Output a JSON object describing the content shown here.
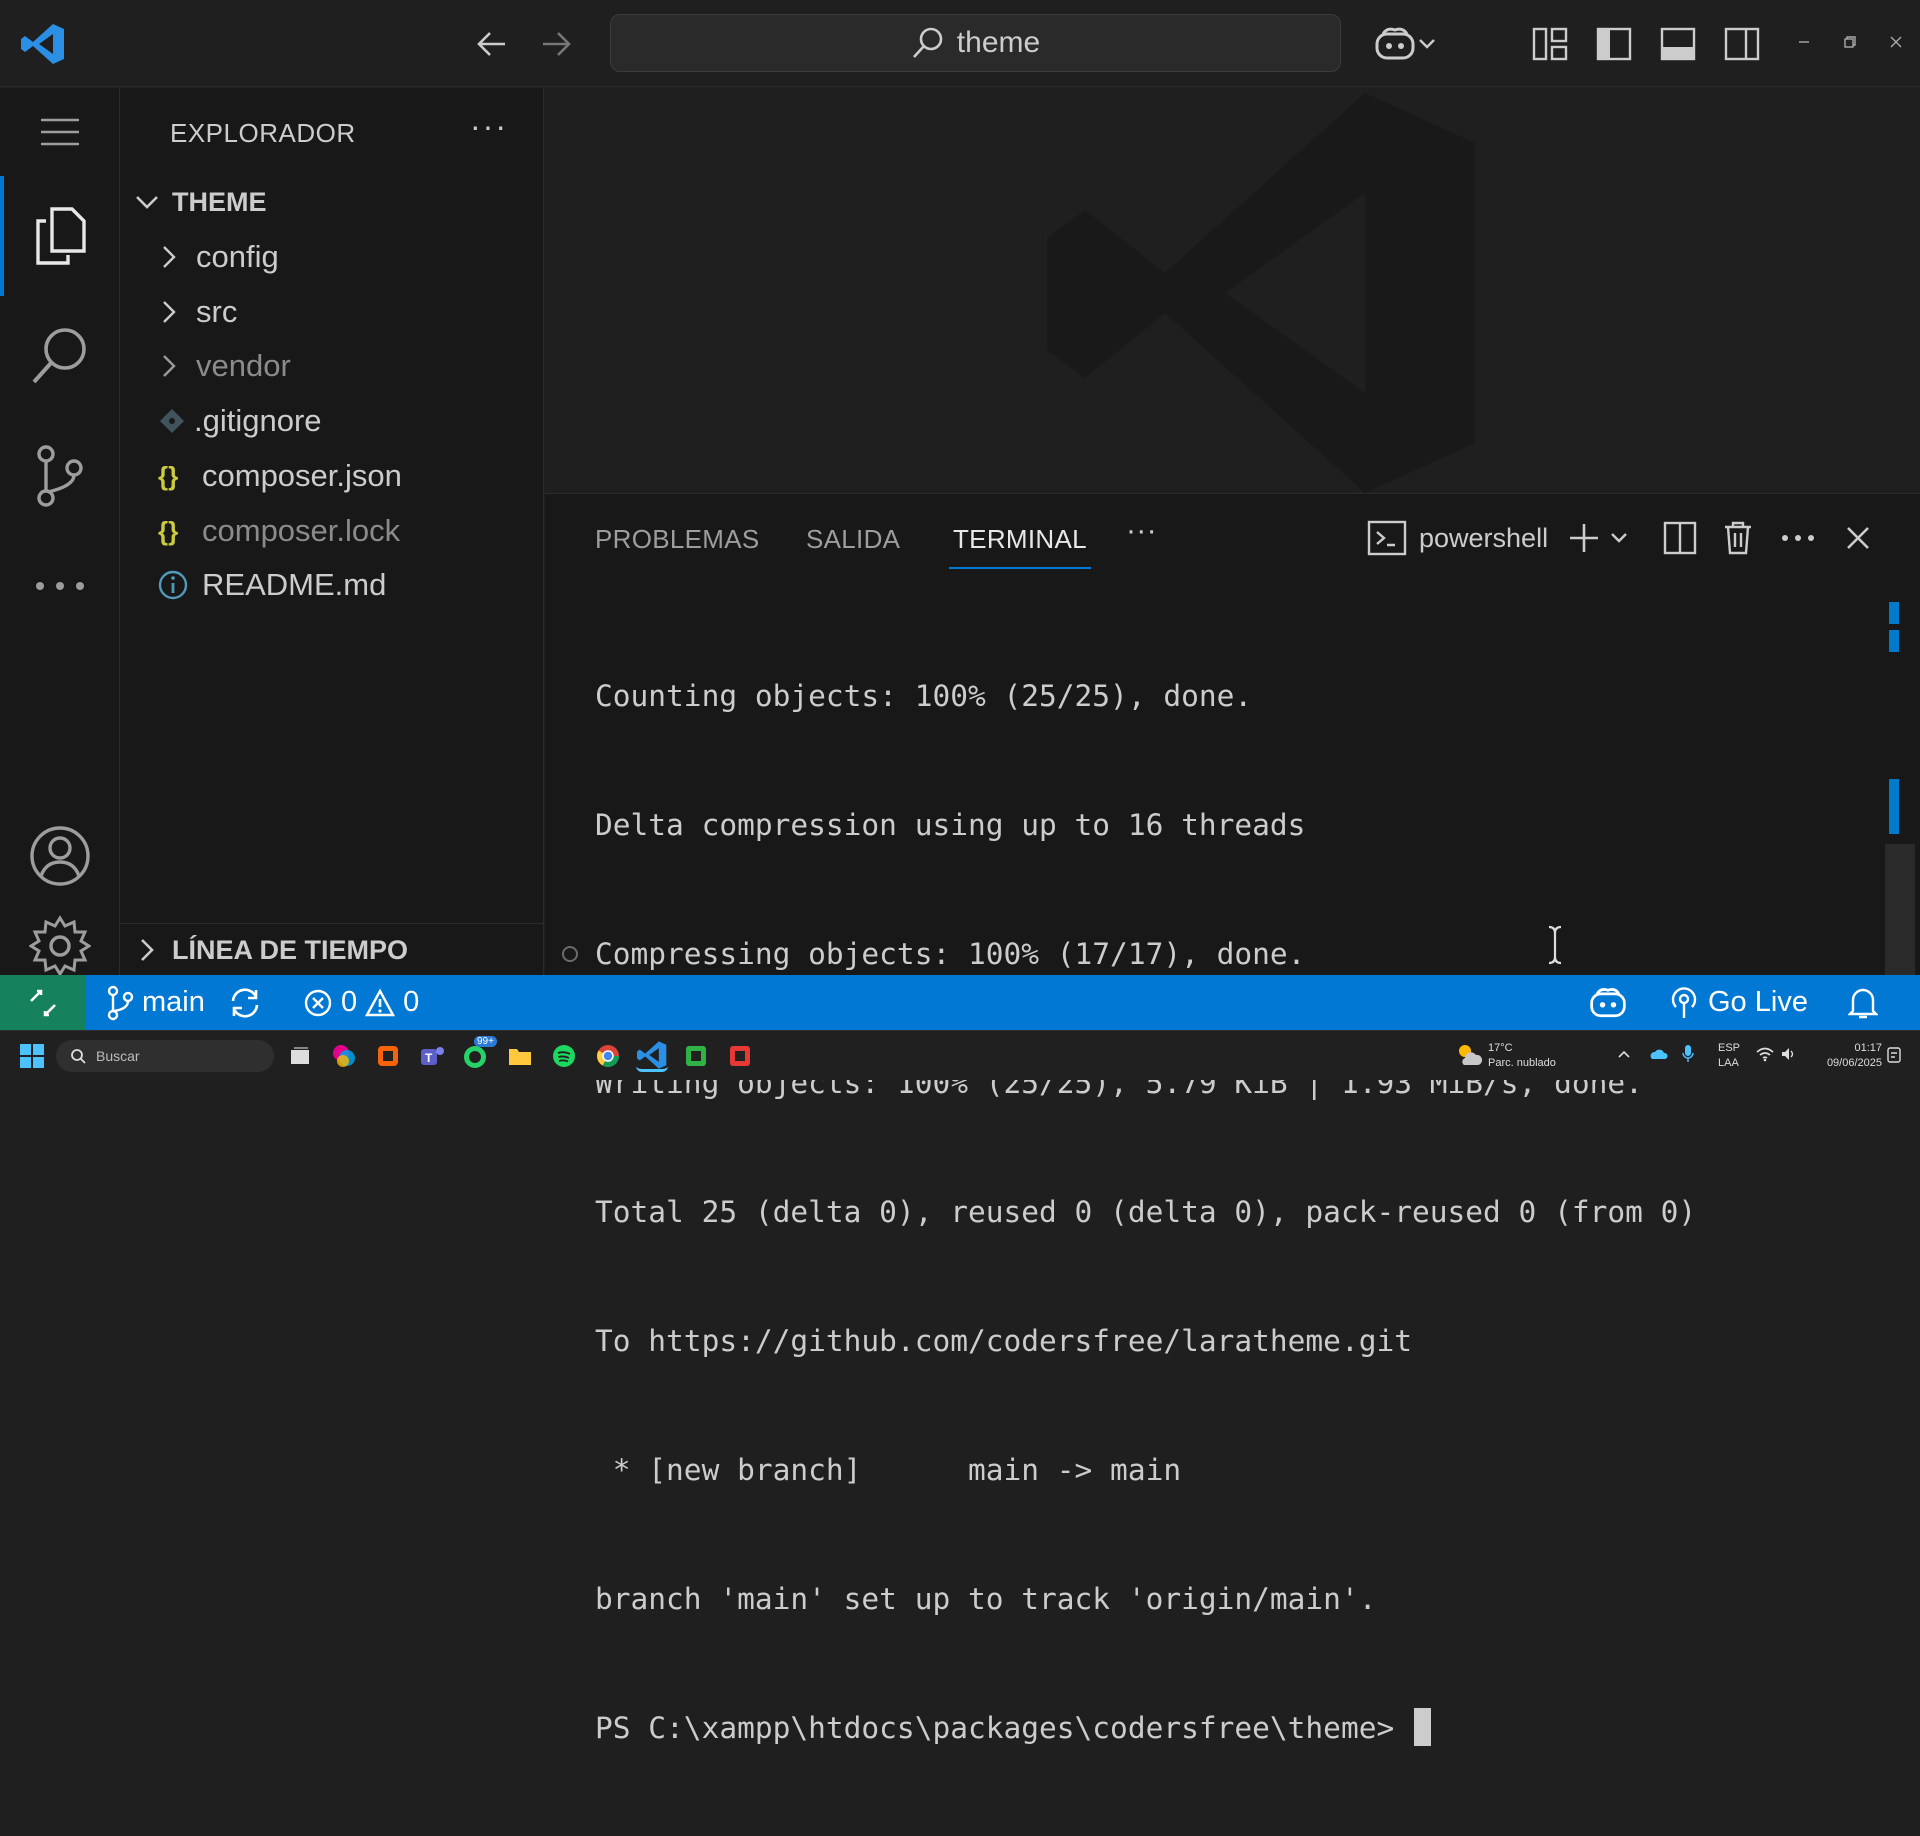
{
  "titlebar": {
    "search_text": "theme"
  },
  "sidebar": {
    "title": "EXPLORADOR",
    "more": "···",
    "root": "THEME",
    "items": [
      {
        "label": "config",
        "kind": "folder"
      },
      {
        "label": "src",
        "kind": "folder"
      },
      {
        "label": "vendor",
        "kind": "folder"
      },
      {
        "label": ".gitignore",
        "kind": "git"
      },
      {
        "label": "composer.json",
        "kind": "json"
      },
      {
        "label": "composer.lock",
        "kind": "json"
      },
      {
        "label": "README.md",
        "kind": "info"
      }
    ],
    "timeline": "LÍNEA DE TIEMPO"
  },
  "panel": {
    "tabs": [
      "PROBLEMAS",
      "SALIDA",
      "TERMINAL"
    ],
    "active_tab": "TERMINAL",
    "more": "···",
    "shell": "powershell",
    "terminal_lines": [
      "Counting objects: 100% (25/25), done.",
      "Delta compression using up to 16 threads",
      "Compressing objects: 100% (17/17), done.",
      "Writing objects: 100% (25/25), 5.79 KiB | 1.93 MiB/s, done.",
      "Total 25 (delta 0), reused 0 (delta 0), pack-reused 0 (from 0)",
      "To https://github.com/codersfree/laratheme.git",
      " * [new branch]      main -> main",
      "branch 'main' set up to track 'origin/main'."
    ],
    "prompt": "PS C:\\xampp\\htdocs\\packages\\codersfree\\theme>"
  },
  "statusbar": {
    "branch": "main",
    "errors": "0",
    "warnings": "0",
    "go_live": "Go Live"
  },
  "taskbar": {
    "search_placeholder": "Buscar",
    "badge": "99+",
    "weather_temp": "17°C",
    "weather_desc": "Parc. nublado",
    "lang_1": "ESP",
    "lang_2": "LAA",
    "time": "01:17",
    "date": "09/06/2025"
  },
  "colors": {
    "accent": "#0078d4",
    "remote": "#16825d",
    "json_icon": "#cbcb41"
  }
}
